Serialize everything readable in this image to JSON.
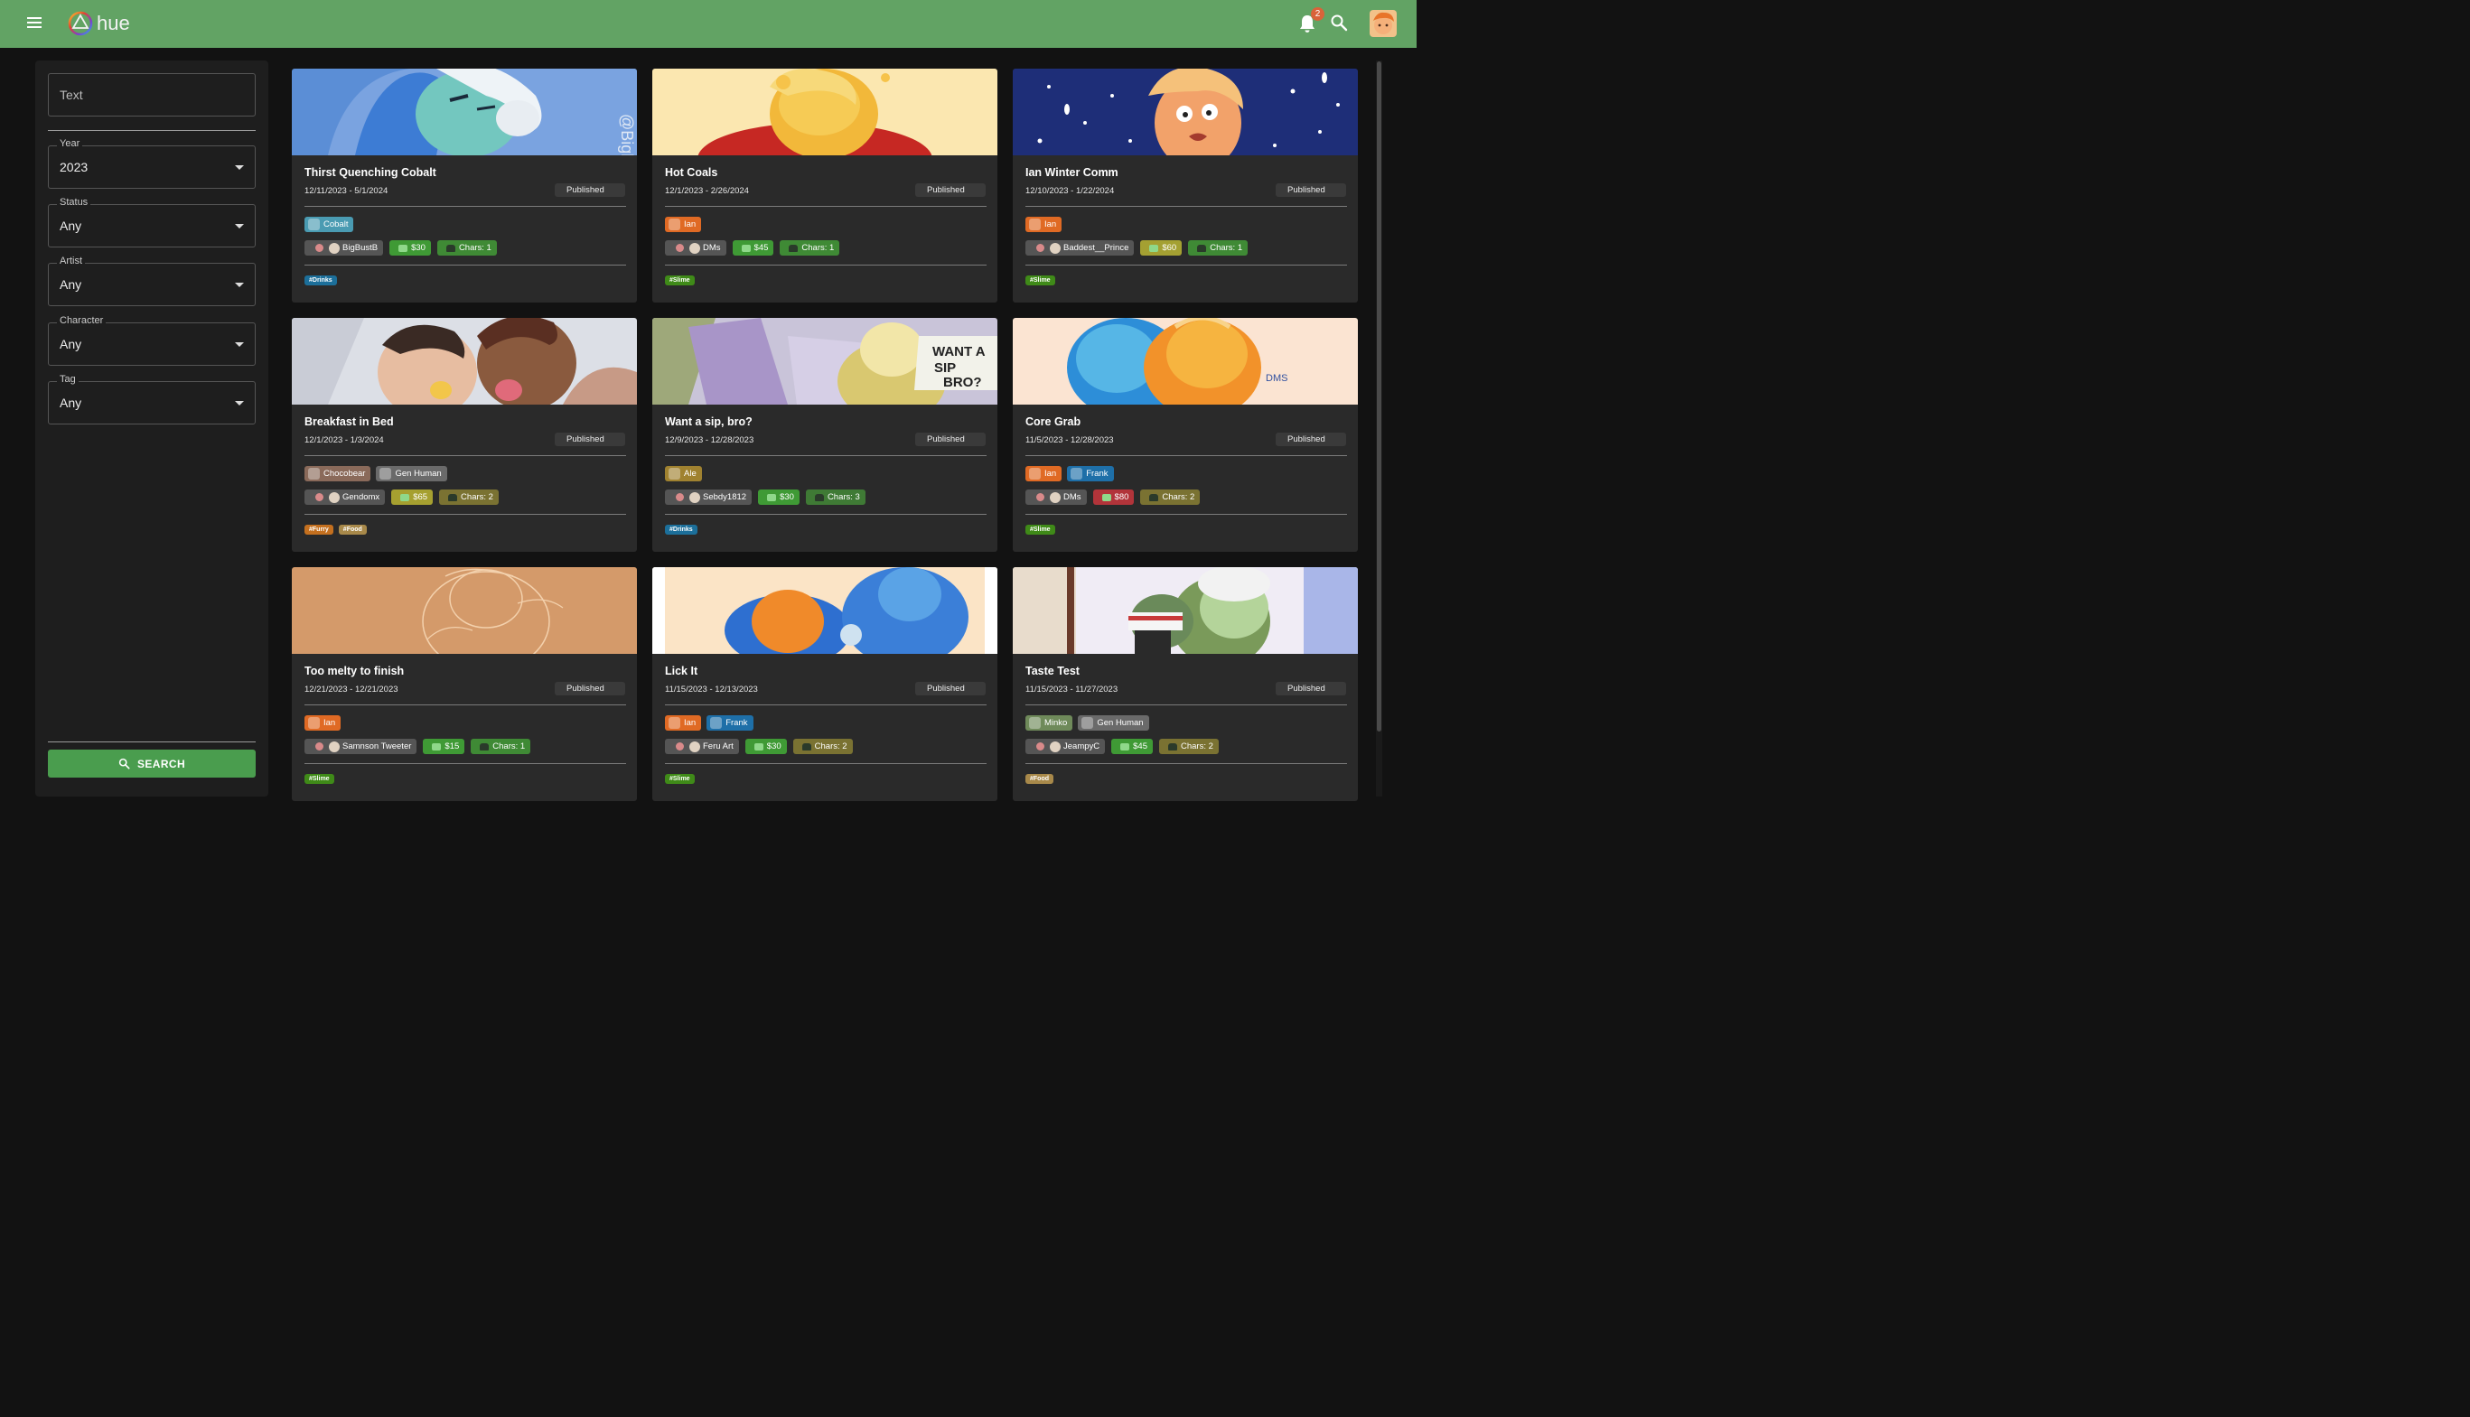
{
  "app": {
    "title": "hue"
  },
  "header": {
    "notification_count": "2"
  },
  "filters": {
    "text_placeholder": "Text",
    "year": {
      "label": "Year",
      "value": "2023"
    },
    "status": {
      "label": "Status",
      "value": "Any"
    },
    "artist": {
      "label": "Artist",
      "value": "Any"
    },
    "character": {
      "label": "Character",
      "value": "Any"
    },
    "tag": {
      "label": "Tag",
      "value": "Any"
    },
    "search_label": "SEARCH"
  },
  "colors": {
    "appbar": "#62a364",
    "search_button": "#4a9d4e",
    "card": "#2a2a2a",
    "ian": "#e06a24",
    "cobalt": "#3e8fa6",
    "frank": "#1e6fa8",
    "slime_tag": "#3f8a18",
    "drinks_tag": "#1c6f9a",
    "furry_tag": "#c4701f",
    "food_tag": "#a8894a"
  },
  "cards": [
    {
      "title": "Thirst Quenching Cobalt",
      "dates": "12/11/2023 - 5/1/2024",
      "status": "Published",
      "characters": [
        {
          "name": "Cobalt",
          "color": "#4a9bb2"
        }
      ],
      "artist": "BigBustB",
      "price": "$30",
      "price_color": "#3f9a35",
      "chars": "Chars: 1",
      "chars_color": "#3f8a35",
      "tags": [
        {
          "name": "#Drinks",
          "color": "#1c6f9a"
        }
      ]
    },
    {
      "title": "Hot Coals",
      "dates": "12/1/2023 - 2/26/2024",
      "status": "Published",
      "characters": [
        {
          "name": "Ian",
          "color": "#e06a24"
        }
      ],
      "artist": "DMs",
      "price": "$45",
      "price_color": "#3f9a35",
      "chars": "Chars: 1",
      "chars_color": "#3f8a35",
      "tags": [
        {
          "name": "#Slime",
          "color": "#3f8a18"
        }
      ]
    },
    {
      "title": "Ian Winter Comm",
      "dates": "12/10/2023 - 1/22/2024",
      "status": "Published",
      "characters": [
        {
          "name": "Ian",
          "color": "#e06a24"
        }
      ],
      "artist": "Baddest__Prince",
      "price": "$60",
      "price_color": "#a4a032",
      "chars": "Chars: 1",
      "chars_color": "#3f8a35",
      "tags": [
        {
          "name": "#Slime",
          "color": "#3f8a18"
        }
      ]
    },
    {
      "title": "Breakfast in Bed",
      "dates": "12/1/2023 - 1/3/2024",
      "status": "Published",
      "characters": [
        {
          "name": "Chocobear",
          "color": "#8a6a5a"
        },
        {
          "name": "Gen Human",
          "color": "#6a6a6a"
        }
      ],
      "artist": "Gendomx",
      "price": "$65",
      "price_color": "#a6a030",
      "chars": "Chars: 2",
      "chars_color": "#7a7232",
      "tags": [
        {
          "name": "#Furry",
          "color": "#c4701f"
        },
        {
          "name": "#Food",
          "color": "#a8894a"
        }
      ]
    },
    {
      "title": "Want a sip, bro?",
      "dates": "12/9/2023 - 12/28/2023",
      "status": "Published",
      "characters": [
        {
          "name": "Ale",
          "color": "#a08230"
        }
      ],
      "artist": "Sebdy1812",
      "price": "$30",
      "price_color": "#3f9a35",
      "chars": "Chars: 3",
      "chars_color": "#3f7a35",
      "tags": [
        {
          "name": "#Drinks",
          "color": "#1c6f9a"
        }
      ]
    },
    {
      "title": "Core Grab",
      "dates": "11/5/2023 - 12/28/2023",
      "status": "Published",
      "characters": [
        {
          "name": "Ian",
          "color": "#e06a24"
        },
        {
          "name": "Frank",
          "color": "#1e6fa8"
        }
      ],
      "artist": "DMs",
      "price": "$80",
      "price_color": "#b2343a",
      "chars": "Chars: 2",
      "chars_color": "#7a7232",
      "tags": [
        {
          "name": "#Slime",
          "color": "#3f8a18"
        }
      ]
    },
    {
      "title": "Too melty to finish",
      "dates": "12/21/2023 - 12/21/2023",
      "status": "Published",
      "characters": [
        {
          "name": "Ian",
          "color": "#e06a24"
        }
      ],
      "artist": "Samnson Tweeter",
      "price": "$15",
      "price_color": "#3f9a35",
      "chars": "Chars: 1",
      "chars_color": "#3f8a35",
      "tags": [
        {
          "name": "#Slime",
          "color": "#3f8a18"
        }
      ]
    },
    {
      "title": "Lick It",
      "dates": "11/15/2023 - 12/13/2023",
      "status": "Published",
      "characters": [
        {
          "name": "Ian",
          "color": "#e06a24"
        },
        {
          "name": "Frank",
          "color": "#1e6fa8"
        }
      ],
      "artist": "Feru Art",
      "price": "$30",
      "price_color": "#3f9a35",
      "chars": "Chars: 2",
      "chars_color": "#7a7232",
      "tags": [
        {
          "name": "#Slime",
          "color": "#3f8a18"
        }
      ]
    },
    {
      "title": "Taste Test",
      "dates": "11/15/2023 - 11/27/2023",
      "status": "Published",
      "characters": [
        {
          "name": "Minko",
          "color": "#6f8a5a"
        },
        {
          "name": "Gen Human",
          "color": "#6a6a6a"
        }
      ],
      "artist": "JeampyC",
      "price": "$45",
      "price_color": "#3f9a35",
      "chars": "Chars: 2",
      "chars_color": "#7a7232",
      "tags": [
        {
          "name": "#Food",
          "color": "#a8894a"
        }
      ]
    }
  ]
}
